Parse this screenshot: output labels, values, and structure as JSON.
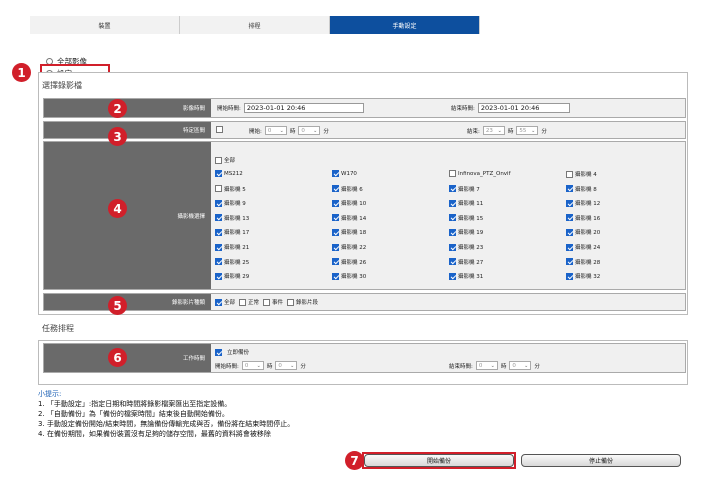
{
  "tabs": [
    {
      "label": "裝置"
    },
    {
      "label": "排程"
    },
    {
      "label": "手動設定"
    }
  ],
  "source": {
    "all_label": "全部影像",
    "custom_label": "設定"
  },
  "select_recording": {
    "title": "選擇錄影檔",
    "time": {
      "label": "影像時間",
      "start_label": "開始時間:",
      "start_value": "2023-01-01 20:46",
      "end_label": "結束時間:",
      "end_value": "2023-01-01 20:46"
    },
    "period": {
      "label": "特定區間",
      "start_label": "開始:",
      "start_hour": "0",
      "hour_unit": "時",
      "start_min": "0",
      "min_unit": "分",
      "end_label": "結束:",
      "end_hour": "23",
      "end_min": "55"
    },
    "cameras": {
      "label": "攝影機選擇",
      "all_label": "全部",
      "items": [
        {
          "name": "MS212",
          "checked": true
        },
        {
          "name": "W170",
          "checked": true
        },
        {
          "name": "Infinova_PTZ_Onvif",
          "checked": false
        },
        {
          "name": "攝影機 4",
          "checked": false
        },
        {
          "name": "攝影機 5",
          "checked": false
        },
        {
          "name": "攝影機 6",
          "checked": true
        },
        {
          "name": "攝影機 7",
          "checked": true
        },
        {
          "name": "攝影機 8",
          "checked": true
        },
        {
          "name": "攝影機 9",
          "checked": true
        },
        {
          "name": "攝影機 10",
          "checked": true
        },
        {
          "name": "攝影機 11",
          "checked": true
        },
        {
          "name": "攝影機 12",
          "checked": true
        },
        {
          "name": "攝影機 13",
          "checked": true
        },
        {
          "name": "攝影機 14",
          "checked": true
        },
        {
          "name": "攝影機 15",
          "checked": true
        },
        {
          "name": "攝影機 16",
          "checked": true
        },
        {
          "name": "攝影機 17",
          "checked": true
        },
        {
          "name": "攝影機 18",
          "checked": true
        },
        {
          "name": "攝影機 19",
          "checked": true
        },
        {
          "name": "攝影機 20",
          "checked": true
        },
        {
          "name": "攝影機 21",
          "checked": true
        },
        {
          "name": "攝影機 22",
          "checked": true
        },
        {
          "name": "攝影機 23",
          "checked": true
        },
        {
          "name": "攝影機 24",
          "checked": true
        },
        {
          "name": "攝影機 25",
          "checked": true
        },
        {
          "name": "攝影機 26",
          "checked": true
        },
        {
          "name": "攝影機 27",
          "checked": true
        },
        {
          "name": "攝影機 28",
          "checked": true
        },
        {
          "name": "攝影機 29",
          "checked": true
        },
        {
          "name": "攝影機 30",
          "checked": true
        },
        {
          "name": "攝影機 31",
          "checked": true
        },
        {
          "name": "攝影機 32",
          "checked": true
        }
      ]
    },
    "types": {
      "label": "錄影影片種類",
      "options": [
        {
          "name": "全部",
          "checked": true
        },
        {
          "name": "正常",
          "checked": false
        },
        {
          "name": "事件",
          "checked": false
        },
        {
          "name": "錄影片段",
          "checked": false
        }
      ]
    }
  },
  "task_schedule": {
    "title": "任務排程",
    "label": "工作時間",
    "immediate_label": "立即備份",
    "start_label": "開始時間:",
    "start_hour": "0",
    "hour_unit": "時",
    "start_min": "0",
    "min_unit": "分",
    "end_label": "結束時間:",
    "end_hour": "0",
    "end_min": "0"
  },
  "tips": {
    "title": "小提示:",
    "lines": [
      "1. 「手動設定」:指定日期和時間將錄影檔案匯出至指定設備。",
      "2. 「自動備份」為「備份的檔案時間」結束後自動開始備份。",
      "3. 手動設定備份開始/結束時間，無論備份傳輸完成與否，備份將在結束時間停止。",
      "4. 在備份期間，如果備份裝置沒有足夠的儲存空間，最舊的資料將會被移除"
    ]
  },
  "buttons": {
    "start": "開始備份",
    "stop": "停止備份"
  },
  "badges": [
    "1",
    "2",
    "3",
    "4",
    "5",
    "6",
    "7"
  ],
  "colors": {
    "accent": "#0d4f9e",
    "badge": "#d11f2a",
    "checkbox": "#1a63c9"
  }
}
